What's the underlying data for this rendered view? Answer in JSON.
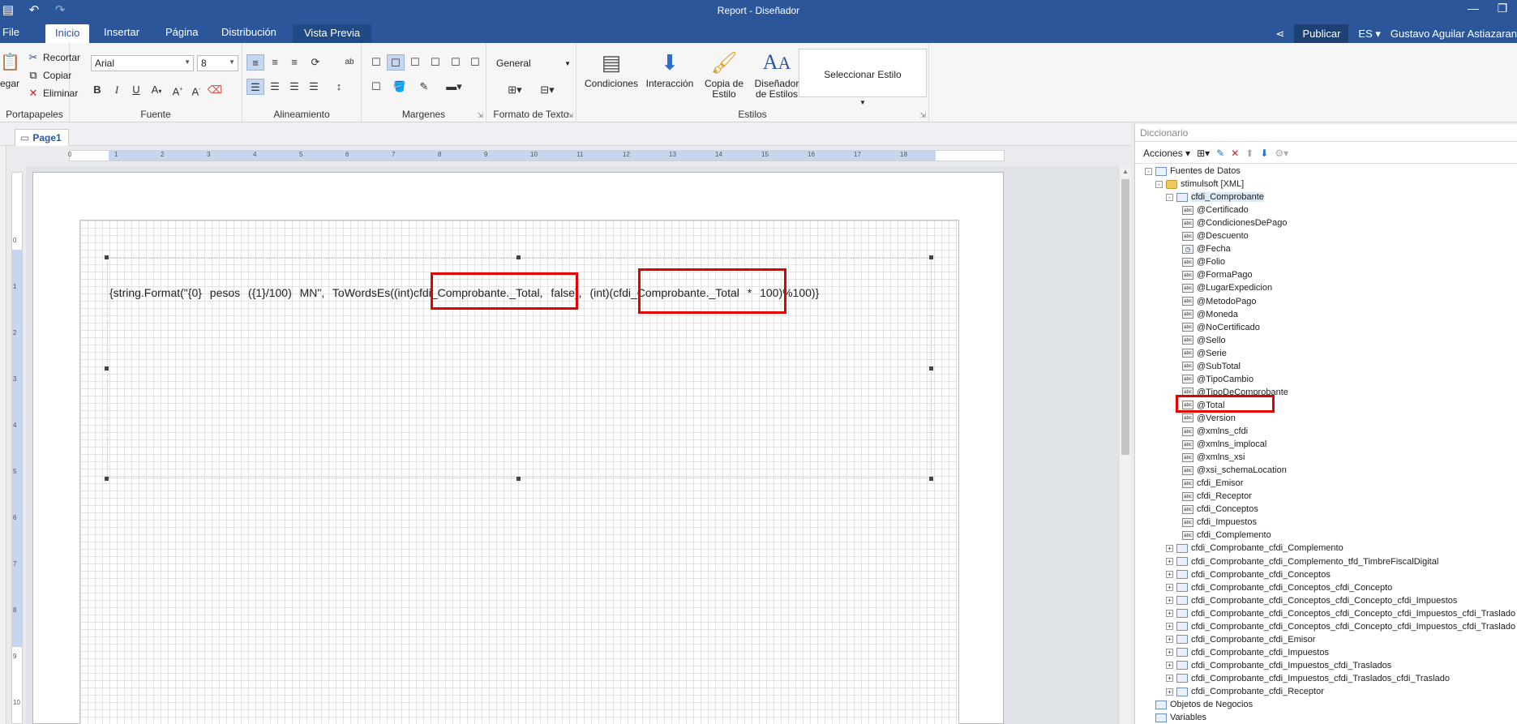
{
  "titlebar": {
    "title": "Report - Diseñador"
  },
  "tabs": [
    {
      "label": "File"
    },
    {
      "label": "Inicio"
    },
    {
      "label": "Insertar"
    },
    {
      "label": "Página"
    },
    {
      "label": "Distribución"
    },
    {
      "label": "Vista Previa"
    }
  ],
  "topright": {
    "publish": "Publicar",
    "lang": "ES",
    "user": "Gustavo Aguilar Astiazaran"
  },
  "ribbon": {
    "clipboard": {
      "paste": "egar",
      "cut": "Recortar",
      "copy": "Copiar",
      "delete": "Eliminar",
      "label": "Portapapeles"
    },
    "font": {
      "family": "Arial",
      "size": "8",
      "label": "Fuente"
    },
    "alignment": {
      "label": "Alineamiento"
    },
    "margins": {
      "label": "Margenes"
    },
    "textformat": {
      "value": "General",
      "label": "Formato de Texto"
    },
    "styles": {
      "conditions": "Condiciones",
      "interaction": "Interacción",
      "copy_style_1": "Copia de",
      "copy_style_2": "Estilo",
      "designer_1": "Diseñador",
      "designer_2": "de Estilos",
      "select_style": "Seleccionar Estilo",
      "label": "Estilos"
    }
  },
  "page_tab": {
    "label": "Page1"
  },
  "ruler_h": [
    "0",
    "1",
    "2",
    "3",
    "4",
    "5",
    "6",
    "7",
    "8",
    "9",
    "10",
    "11",
    "12",
    "13",
    "14",
    "15",
    "16",
    "17",
    "18"
  ],
  "ruler_v": [
    "0",
    "1",
    "2",
    "3",
    "4",
    "5",
    "6",
    "7",
    "8",
    "9",
    "10"
  ],
  "report": {
    "expression": "{string.Format(\"{0} pesos ({1}/100) MN\", ToWordsEs((int)cfdi_Comprobante._Total, false), (int)(cfdi_Comprobante._Total * 100)%100)}"
  },
  "dictionary": {
    "title": "Diccionario",
    "actions": "Acciones",
    "tree": [
      {
        "label": "Fuentes de Datos",
        "level": 0,
        "expand": "-",
        "icon": "table"
      },
      {
        "label": "stimulsoft [XML]",
        "level": 1,
        "expand": "-",
        "icon": "db"
      },
      {
        "label": "cfdi_Comprobante",
        "level": 2,
        "expand": "-",
        "icon": "table",
        "selected": true
      },
      {
        "label": "@Certificado",
        "level": 3,
        "icon": "abc"
      },
      {
        "label": "@CondicionesDePago",
        "level": 3,
        "icon": "abc"
      },
      {
        "label": "@Descuento",
        "level": 3,
        "icon": "abc"
      },
      {
        "label": "@Fecha",
        "level": 3,
        "icon": "date"
      },
      {
        "label": "@Folio",
        "level": 3,
        "icon": "abc"
      },
      {
        "label": "@FormaPago",
        "level": 3,
        "icon": "abc"
      },
      {
        "label": "@LugarExpedicion",
        "level": 3,
        "icon": "abc"
      },
      {
        "label": "@MetodoPago",
        "level": 3,
        "icon": "abc"
      },
      {
        "label": "@Moneda",
        "level": 3,
        "icon": "abc"
      },
      {
        "label": "@NoCertificado",
        "level": 3,
        "icon": "abc"
      },
      {
        "label": "@Sello",
        "level": 3,
        "icon": "abc"
      },
      {
        "label": "@Serie",
        "level": 3,
        "icon": "abc"
      },
      {
        "label": "@SubTotal",
        "level": 3,
        "icon": "abc"
      },
      {
        "label": "@TipoCambio",
        "level": 3,
        "icon": "abc"
      },
      {
        "label": "@TipoDeComprobante",
        "level": 3,
        "icon": "abc"
      },
      {
        "label": "@Total",
        "level": 3,
        "icon": "abc"
      },
      {
        "label": "@Version",
        "level": 3,
        "icon": "abc"
      },
      {
        "label": "@xmlns_cfdi",
        "level": 3,
        "icon": "abc"
      },
      {
        "label": "@xmlns_implocal",
        "level": 3,
        "icon": "abc"
      },
      {
        "label": "@xmlns_xsi",
        "level": 3,
        "icon": "abc"
      },
      {
        "label": "@xsi_schemaLocation",
        "level": 3,
        "icon": "abc"
      },
      {
        "label": "cfdi_Emisor",
        "level": 3,
        "icon": "abc"
      },
      {
        "label": "cfdi_Receptor",
        "level": 3,
        "icon": "abc"
      },
      {
        "label": "cfdi_Conceptos",
        "level": 3,
        "icon": "abc"
      },
      {
        "label": "cfdi_Impuestos",
        "level": 3,
        "icon": "abc"
      },
      {
        "label": "cfdi_Complemento",
        "level": 3,
        "icon": "abc"
      },
      {
        "label": "cfdi_Comprobante_cfdi_Complemento",
        "level": 2,
        "expand": "+",
        "icon": "table"
      },
      {
        "label": "cfdi_Comprobante_cfdi_Complemento_tfd_TimbreFiscalDigital",
        "level": 2,
        "expand": "+",
        "icon": "table"
      },
      {
        "label": "cfdi_Comprobante_cfdi_Conceptos",
        "level": 2,
        "expand": "+",
        "icon": "table"
      },
      {
        "label": "cfdi_Comprobante_cfdi_Conceptos_cfdi_Concepto",
        "level": 2,
        "expand": "+",
        "icon": "table"
      },
      {
        "label": "cfdi_Comprobante_cfdi_Conceptos_cfdi_Concepto_cfdi_Impuestos",
        "level": 2,
        "expand": "+",
        "icon": "table"
      },
      {
        "label": "cfdi_Comprobante_cfdi_Conceptos_cfdi_Concepto_cfdi_Impuestos_cfdi_Traslado",
        "level": 2,
        "expand": "+",
        "icon": "table"
      },
      {
        "label": "cfdi_Comprobante_cfdi_Conceptos_cfdi_Concepto_cfdi_Impuestos_cfdi_Traslado",
        "level": 2,
        "expand": "+",
        "icon": "table"
      },
      {
        "label": "cfdi_Comprobante_cfdi_Emisor",
        "level": 2,
        "expand": "+",
        "icon": "table"
      },
      {
        "label": "cfdi_Comprobante_cfdi_Impuestos",
        "level": 2,
        "expand": "+",
        "icon": "table"
      },
      {
        "label": "cfdi_Comprobante_cfdi_Impuestos_cfdi_Traslados",
        "level": 2,
        "expand": "+",
        "icon": "table"
      },
      {
        "label": "cfdi_Comprobante_cfdi_Impuestos_cfdi_Traslados_cfdi_Traslado",
        "level": 2,
        "expand": "+",
        "icon": "table"
      },
      {
        "label": "cfdi_Comprobante_cfdi_Receptor",
        "level": 2,
        "expand": "+",
        "icon": "table"
      },
      {
        "label": "Objetos de Negocios",
        "level": 0,
        "icon": "table"
      },
      {
        "label": "Variables",
        "level": 0,
        "icon": "table"
      }
    ]
  },
  "colors": {
    "accent": "#2b579a",
    "highlight": "#e40000"
  }
}
